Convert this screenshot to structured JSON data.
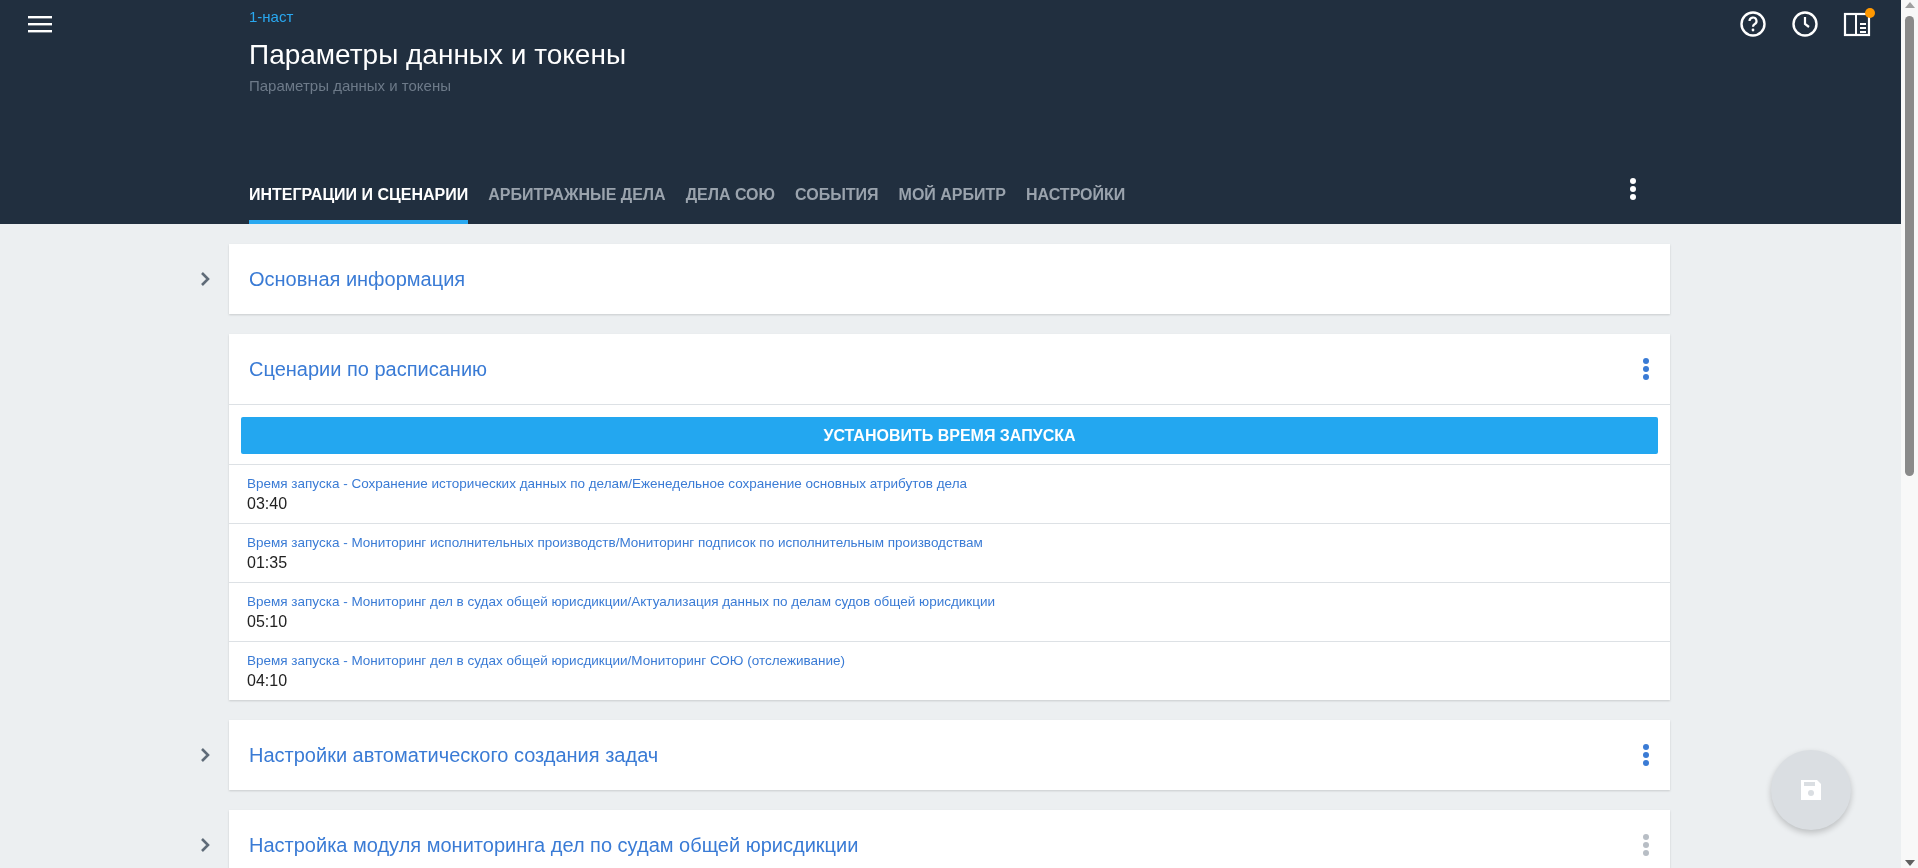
{
  "header": {
    "breadcrumb": "1-наст",
    "title": "Параметры данных и токены",
    "subtitle": "Параметры данных и токены",
    "notification": true
  },
  "tabs": [
    {
      "label": "ИНТЕГРАЦИИ И СЦЕНАРИИ",
      "selected": true
    },
    {
      "label": "АРБИТРАЖНЫЕ ДЕЛА",
      "selected": false
    },
    {
      "label": "ДЕЛА СОЮ",
      "selected": false
    },
    {
      "label": "СОБЫТИЯ",
      "selected": false
    },
    {
      "label": "МОЙ АРБИТР",
      "selected": false
    },
    {
      "label": "НАСТРОЙКИ",
      "selected": false
    }
  ],
  "sections": [
    {
      "title": "Основная информация",
      "expanded": false
    },
    {
      "title": "Сценарии по расписанию",
      "expanded": true,
      "menu_enabled": true,
      "button": "УСТАНОВИТЬ ВРЕМЯ ЗАПУСКА",
      "items": [
        {
          "label": "Время запуска - Сохранение исторических данных по делам/Еженедельное сохранение основных атрибутов дела",
          "value": "03:40"
        },
        {
          "label": "Время запуска - Мониторинг исполнительных производств/Мониторинг подписок по исполнительным производствам",
          "value": "01:35"
        },
        {
          "label": "Время запуска - Мониторинг дел в судах общей юрисдикции/Актуализация данных по делам судов общей юрисдикции",
          "value": "05:10"
        },
        {
          "label": "Время запуска - Мониторинг дел в судах общей юрисдикции/Мониторинг СОЮ (отслеживание)",
          "value": "04:10"
        }
      ]
    },
    {
      "title": "Настройки автоматического создания задач",
      "expanded": false,
      "menu_enabled": true
    },
    {
      "title": "Настройка модуля мониторинга дел по судам общей юрисдикции",
      "expanded": false,
      "menu_enabled": false
    }
  ],
  "save_button": {
    "disabled": true
  }
}
